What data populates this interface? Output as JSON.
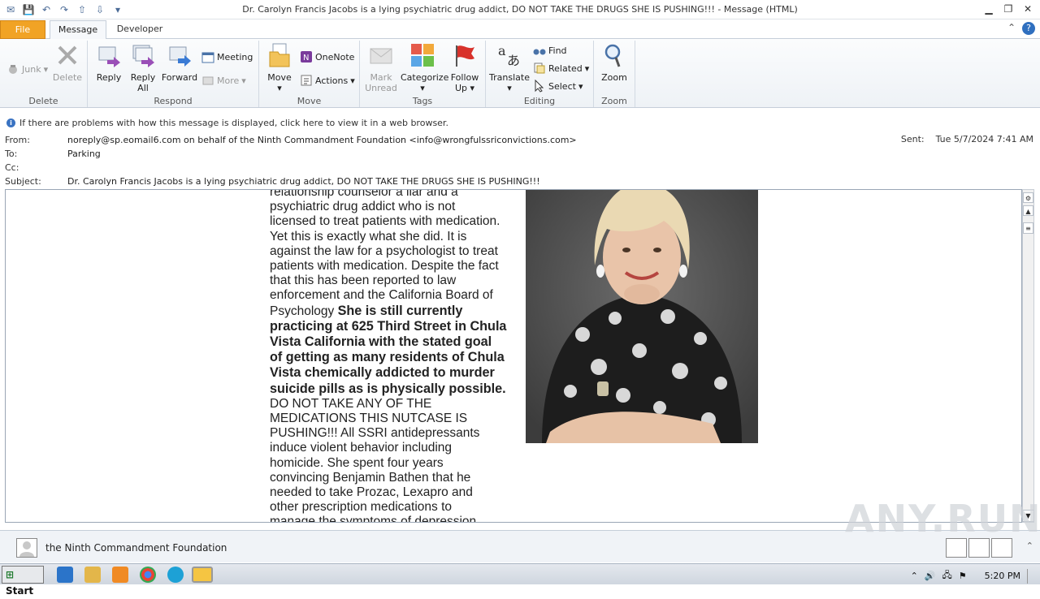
{
  "window": {
    "title": "Dr. Carolyn Francis Jacobs is a lying psychiatric drug addict, DO NOT TAKE THE DRUGS SHE IS PUSHING!!!  -  Message (HTML)"
  },
  "tabs": [
    {
      "label": "File"
    },
    {
      "label": "Message"
    },
    {
      "label": "Developer"
    }
  ],
  "ribbon": {
    "delete": {
      "group": "Delete",
      "junk": "Junk",
      "delete": "Delete"
    },
    "respond": {
      "group": "Respond",
      "reply": "Reply",
      "reply_all_1": "Reply",
      "reply_all_2": "All",
      "forward": "Forward",
      "meeting": "Meeting",
      "more": "More"
    },
    "move": {
      "group": "Move",
      "move": "Move",
      "onenote": "OneNote",
      "actions": "Actions"
    },
    "tags": {
      "group": "Tags",
      "mark_1": "Mark",
      "mark_2": "Unread",
      "categorize": "Categorize",
      "follow_1": "Follow",
      "follow_2": "Up"
    },
    "editing": {
      "group": "Editing",
      "translate": "Translate",
      "find": "Find",
      "related": "Related",
      "select": "Select"
    },
    "zoom": {
      "group": "Zoom",
      "zoom": "Zoom"
    }
  },
  "info": {
    "notice": "If there are problems with how this message is displayed, click here to view it in a web browser."
  },
  "header": {
    "from_label": "From:",
    "from": "noreply@sp.eomail6.com on behalf of the Ninth Commandment Foundation <info@wrongfulssriconvictions.com>",
    "to_label": "To:",
    "to": "Parking",
    "cc_label": "Cc:",
    "cc": "",
    "subject_label": "Subject:",
    "subject": "Dr. Carolyn Francis Jacobs is a lying psychiatric drug addict, DO NOT TAKE THE DRUGS SHE IS PUSHING!!!",
    "sent_label": "Sent:",
    "sent": "Tue 5/7/2024 7:41 AM"
  },
  "body": {
    "lines_a": [
      "relationship counselor a liar and a",
      "psychiatric drug addict who is not",
      "licensed to treat patients with medication.",
      "Yet this is exactly what she did. It is",
      "against the law for a psychologist to treat",
      "patients with medication. Despite the fact",
      "that this has been reported to law",
      "enforcement and the California Board of"
    ],
    "psych_prefix": "Psychology ",
    "psych_bold": "She is still currently",
    "bold_lines": [
      "practicing at 625 Third Street in Chula",
      "Vista California with the stated goal",
      "of getting as many residents of Chula",
      "Vista chemically addicted to murder",
      "suicide pills as is physically possible."
    ],
    "lines_b": [
      "DO NOT TAKE ANY OF THE",
      "MEDICATIONS THIS NUTCASE IS",
      "PUSHING!!! All SSRI antidepressants",
      "induce violent behavior including",
      "homicide. She spent four years",
      "convincing Benjamin Bathen that he",
      "needed to take Prozac, Lexapro and",
      "other prescription medications to",
      "manage the symptoms of depression."
    ]
  },
  "footer": {
    "sender": "the Ninth Commandment Foundation"
  },
  "watermark": "ANY.RUN",
  "taskbar": {
    "start": "Start",
    "time": "5:20 PM"
  }
}
